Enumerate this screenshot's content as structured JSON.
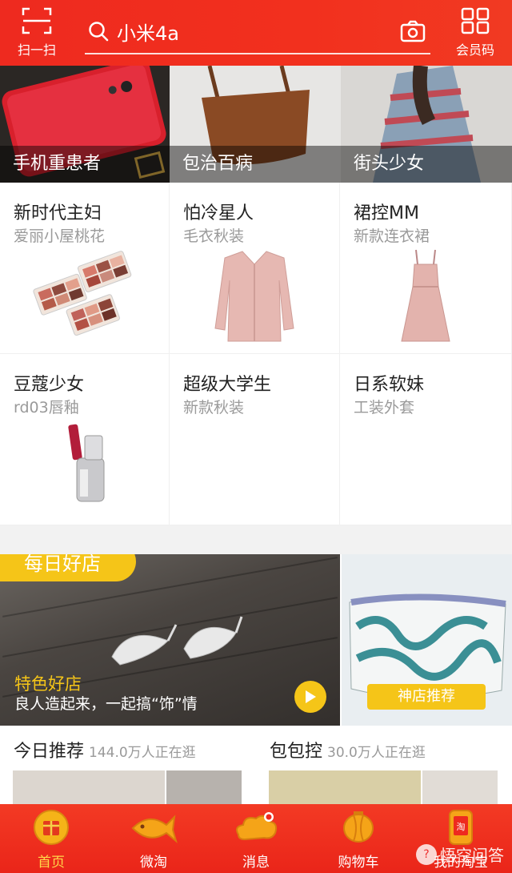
{
  "header": {
    "scan_label": "扫一扫",
    "search_text": "小米4a",
    "member_label": "会员码"
  },
  "banners": [
    {
      "label": "手机重患者"
    },
    {
      "label": "包治百病"
    },
    {
      "label": "街头少女"
    }
  ],
  "grid": [
    {
      "title": "新时代主妇",
      "subtitle": "爱丽小屋桃花"
    },
    {
      "title": "怕冷星人",
      "subtitle": "毛衣秋装"
    },
    {
      "title": "裙控MM",
      "subtitle": "新款连衣裙"
    },
    {
      "title": "豆蔻少女",
      "subtitle": "rd03唇釉"
    },
    {
      "title": "超级大学生",
      "subtitle": "新款秋装"
    },
    {
      "title": "日系软妹",
      "subtitle": "工装外套"
    }
  ],
  "daily": {
    "tag": "每日好店",
    "title": "特色好店",
    "subtitle": "良人造起来，一起搞“饰”情",
    "side_tag": "神店推荐"
  },
  "recommend": [
    {
      "title": "今日推荐",
      "count": "144.0万人正在逛"
    },
    {
      "title": "包包控",
      "count": "30.0万人正在逛"
    }
  ],
  "tabs": [
    {
      "label": "首页",
      "icon": "home-icon"
    },
    {
      "label": "微淘",
      "icon": "fish-icon"
    },
    {
      "label": "消息",
      "icon": "cloud-message-icon"
    },
    {
      "label": "购物车",
      "icon": "lantern-cart-icon"
    },
    {
      "label": "我的淘宝",
      "icon": "phone-taobao-icon"
    }
  ],
  "watermark": "悟空问答",
  "colors": {
    "brand_red": "#f2301e",
    "accent_yellow": "#f5c518"
  }
}
